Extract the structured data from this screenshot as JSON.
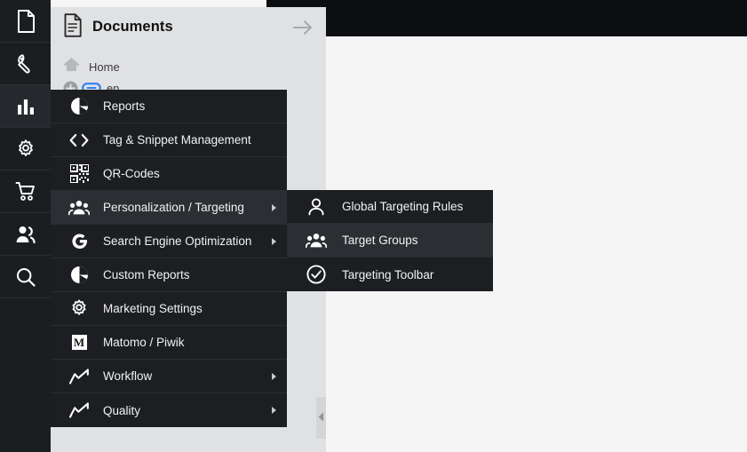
{
  "rail": {
    "items": [
      {
        "icon": "document-icon",
        "name": "rail-item-documents",
        "active": false
      },
      {
        "icon": "wrench-icon",
        "name": "rail-item-tools",
        "active": false
      },
      {
        "icon": "bar-chart-icon",
        "name": "rail-item-marketing",
        "active": true
      },
      {
        "icon": "gear-icon",
        "name": "rail-item-settings",
        "active": false
      },
      {
        "icon": "cart-icon",
        "name": "rail-item-ecommerce",
        "active": false
      },
      {
        "icon": "users-icon",
        "name": "rail-item-customers",
        "active": false
      },
      {
        "icon": "search-icon",
        "name": "rail-item-search",
        "active": false
      }
    ]
  },
  "panel": {
    "title": "Documents",
    "title_icon": "document-lines-icon",
    "forward_icon": "arrow-right-icon",
    "tree": {
      "home_label": "Home",
      "home_icon": "home-icon",
      "lang_label": "en",
      "lang_icon": "link-icon",
      "expand_icon": "plus-circle-icon"
    },
    "collapse_handle_icon": "caret-left-icon"
  },
  "menu": {
    "items": [
      {
        "label": "Reports",
        "icon": "pie-chart-icon",
        "has_submenu": false,
        "highlighted": false
      },
      {
        "label": "Tag & Snippet Management",
        "icon": "code-brackets-icon",
        "has_submenu": false,
        "highlighted": false
      },
      {
        "label": "QR-Codes",
        "icon": "qr-code-icon",
        "has_submenu": false,
        "highlighted": false
      },
      {
        "label": "Personalization / Targeting",
        "icon": "group-icon",
        "has_submenu": true,
        "highlighted": true
      },
      {
        "label": "Search Engine Optimization",
        "icon": "google-g-icon",
        "has_submenu": true,
        "highlighted": false
      },
      {
        "label": "Custom Reports",
        "icon": "pie-chart-icon",
        "has_submenu": false,
        "highlighted": false
      },
      {
        "label": "Marketing Settings",
        "icon": "gear-icon",
        "has_submenu": false,
        "highlighted": false
      },
      {
        "label": "Matomo / Piwik",
        "icon": "matomo-m-icon",
        "has_submenu": false,
        "highlighted": false
      },
      {
        "label": "Workflow",
        "icon": "trend-line-icon",
        "has_submenu": true,
        "highlighted": false
      },
      {
        "label": "Quality",
        "icon": "trend-line-icon",
        "has_submenu": true,
        "highlighted": false
      }
    ]
  },
  "submenu": {
    "items": [
      {
        "label": "Global Targeting Rules",
        "icon": "person-icon",
        "highlighted": false
      },
      {
        "label": "Target Groups",
        "icon": "group-icon",
        "highlighted": true
      },
      {
        "label": "Targeting Toolbar",
        "icon": "check-circle-icon",
        "highlighted": false
      }
    ]
  },
  "colors": {
    "rail_bg": "#1b1e21",
    "menu_bg": "#1c1e21",
    "menu_highlight": "#2b2e32",
    "panel_bg": "#e0e1e3",
    "content_bg": "#f5f5f6",
    "topbar_bg": "#0c0f12",
    "link_blue": "#2d7ff9"
  }
}
